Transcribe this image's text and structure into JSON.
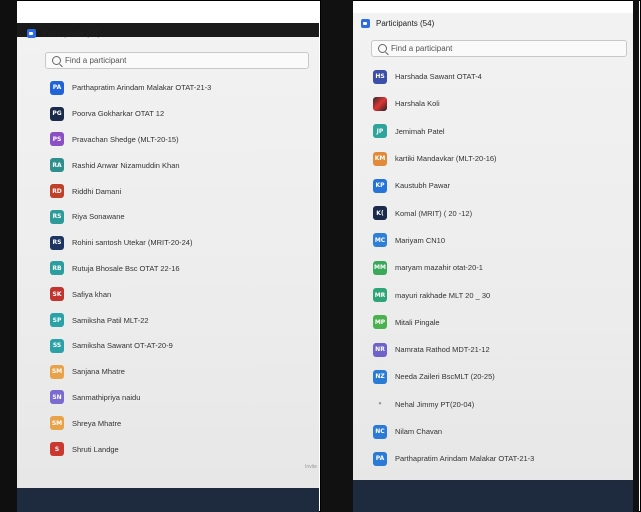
{
  "left_panel": {
    "title": "Participants (54)",
    "search_placeholder": "Find a participant",
    "invite_hint": "Invite",
    "participants": [
      {
        "initials": "PA",
        "name": "Parthapratim Arindam Malakar OTAT-21-3",
        "color": "#1f63d6"
      },
      {
        "initials": "PG",
        "name": "Poorva Gokharkar OTAT 12",
        "color": "#1a2a4a"
      },
      {
        "initials": "PS",
        "name": "Pravachan Shedge (MLT-20-15)",
        "color": "#8a4fc4"
      },
      {
        "initials": "RA",
        "name": "Rashid Anwar Nizamuddin Khan",
        "color": "#2f8f8f"
      },
      {
        "initials": "RD",
        "name": "Riddhi Damani",
        "color": "#c0402a"
      },
      {
        "initials": "RS",
        "name": "Riya Sonawane",
        "color": "#2f9a9a"
      },
      {
        "initials": "RS",
        "name": "Rohini santosh Utekar (MRIT-20-24)",
        "color": "#1d3560"
      },
      {
        "initials": "RB",
        "name": "Rutuja Bhosale Bsc OTAT 22-16",
        "color": "#2b9ea0"
      },
      {
        "initials": "SK",
        "name": "Safiya khan",
        "color": "#c2342e"
      },
      {
        "initials": "SP",
        "name": "Samiksha Patil MLT-22",
        "color": "#2aa2a8"
      },
      {
        "initials": "SS",
        "name": "Samiksha Sawant OT-AT-20-9",
        "color": "#2aa2a8"
      },
      {
        "initials": "SM",
        "name": "Sanjana Mhatre",
        "color": "#e8a24a"
      },
      {
        "initials": "SN",
        "name": "Sanmathipriya naidu",
        "color": "#7b6bd0"
      },
      {
        "initials": "SM",
        "name": "Shreya Mhatre",
        "color": "#e8a24a"
      },
      {
        "initials": "S",
        "name": "Shruti Landge",
        "color": "#c9392f"
      }
    ]
  },
  "right_panel": {
    "title": "Participants (54)",
    "search_placeholder": "Find a participant",
    "participants": [
      {
        "initials": "HS",
        "name": "Harshada Sawant OTAT-4",
        "color": "#3c4fa8",
        "kind": "initials"
      },
      {
        "initials": "",
        "name": "Harshala Koli",
        "color": "#d33",
        "kind": "photo"
      },
      {
        "initials": "JP",
        "name": "Jemimah Patel",
        "color": "#2ea59b",
        "kind": "initials"
      },
      {
        "initials": "KM",
        "name": "kartiki Mandavkar (MLT-20-16)",
        "color": "#e08a3a",
        "kind": "initials"
      },
      {
        "initials": "KP",
        "name": "Kaustubh Pawar",
        "color": "#2673d9",
        "kind": "initials"
      },
      {
        "initials": "K(",
        "name": "Komal (MRIT) ( 20 -12)",
        "color": "#1b2a4a",
        "kind": "initials"
      },
      {
        "initials": "MC",
        "name": "Mariyam CN10",
        "color": "#2f7fd8",
        "kind": "initials"
      },
      {
        "initials": "MM",
        "name": "maryam mazahir otat-20-1",
        "color": "#3aaa5a",
        "kind": "initials"
      },
      {
        "initials": "MR",
        "name": "mayuri rakhade MLT 20 _ 30",
        "color": "#2ea576",
        "kind": "initials"
      },
      {
        "initials": "MP",
        "name": "Mitali Pingale",
        "color": "#4bb04e",
        "kind": "initials"
      },
      {
        "initials": "NR",
        "name": "Namrata Rathod MDT-21-12",
        "color": "#6e63c9",
        "kind": "initials"
      },
      {
        "initials": "NZ",
        "name": "Needa Zaileri BscMLT (20-25)",
        "color": "#2b7bd6",
        "kind": "initials"
      },
      {
        "initials": "•",
        "name": "Nehal Jimmy PT(20-04)",
        "color": "#999999",
        "kind": "dot"
      },
      {
        "initials": "NC",
        "name": "Nilam Chavan",
        "color": "#2b7bd6",
        "kind": "initials"
      },
      {
        "initials": "PA",
        "name": "Parthapratim Arindam Malakar OTAT-21-3",
        "color": "#2b7bd6",
        "kind": "initials"
      }
    ]
  }
}
